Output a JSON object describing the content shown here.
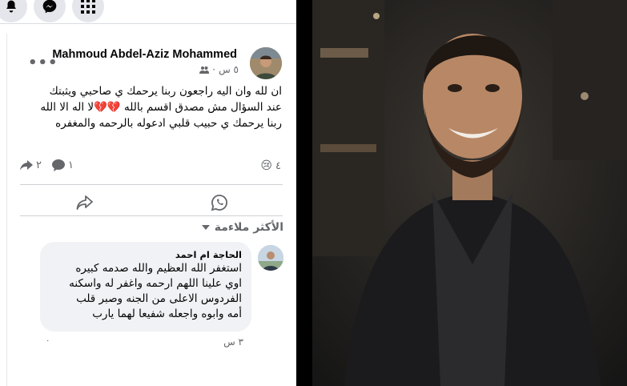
{
  "topbar": {
    "icons": [
      "bell-icon",
      "messenger-icon",
      "grid-menu-icon"
    ]
  },
  "post": {
    "author": "Mahmoud Abdel-Aziz Mohammed",
    "time": "٥ س",
    "audience_icon": "friends-icon",
    "text_lines": [
      "ان لله وان اليه راجعون ربنا يرحمك ي صاحبي ويثبتك",
      "عند السؤال مش مصدق اقسم بالله 💔💔لا اله الا الله",
      "ربنا يرحمك ي حبيب قلبي ادعوله بالرحمه والمغفره"
    ],
    "reaction_emoji": "😢",
    "reaction_count": "٤",
    "comments_count": "١",
    "shares_count": "٢"
  },
  "actions": {
    "share_icon": "share-icon",
    "whatsapp_icon": "whatsapp-icon"
  },
  "comments_filter": {
    "label": "الأكثر ملاءمة"
  },
  "comment": {
    "author": "الحاجة ام احمد",
    "text_lines": [
      "استغفر الله العظيم والله صدمه كبيره",
      "اوي علينا اللهم ارحمه واغفر له واسكنه",
      "الفردوس الاعلى من الجنه وصبر قلب",
      "أمه وابوه واجعله شفيعا لهما يارب"
    ],
    "time": "٣ س",
    "likes": "٠"
  },
  "colors": {
    "text": "#050505",
    "secondary": "#65676b",
    "bubble": "#f0f2f5",
    "button_bg": "#e4e6eb"
  }
}
